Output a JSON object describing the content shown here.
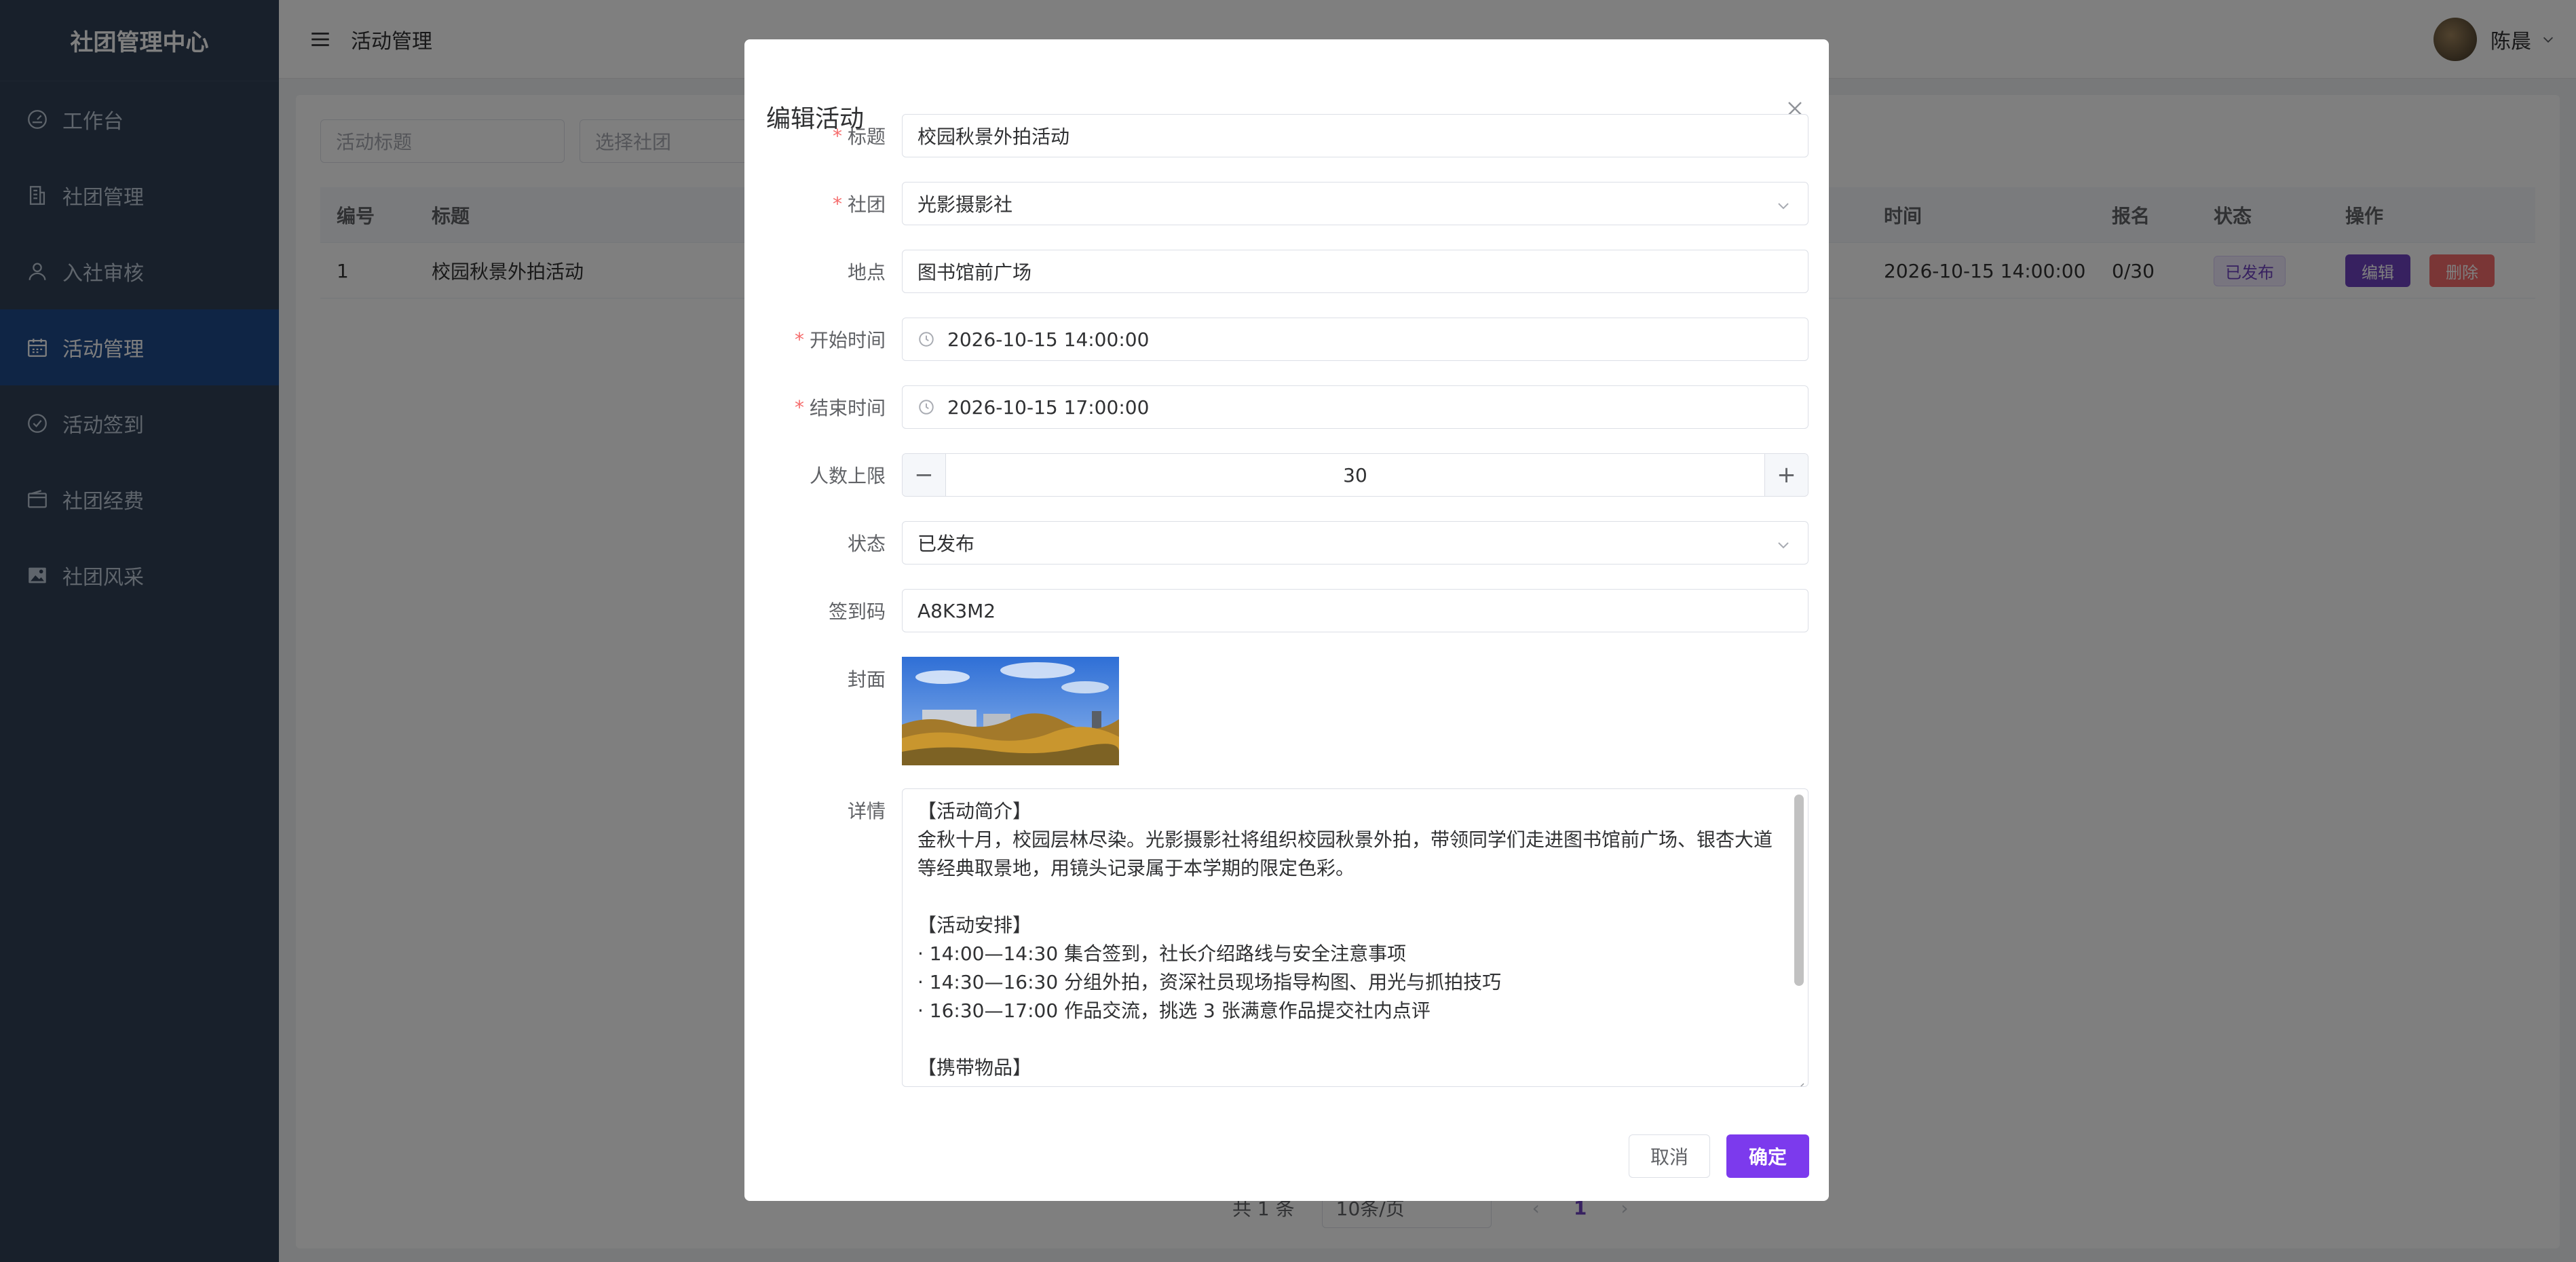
{
  "sidebar": {
    "title": "社团管理中心",
    "items": [
      {
        "label": "工作台",
        "icon": "dashboard-icon"
      },
      {
        "label": "社团管理",
        "icon": "building-icon"
      },
      {
        "label": "入社审核",
        "icon": "user-icon"
      },
      {
        "label": "活动管理",
        "icon": "calendar-icon",
        "active": true
      },
      {
        "label": "活动签到",
        "icon": "check-circle-icon"
      },
      {
        "label": "社团经费",
        "icon": "wallet-icon"
      },
      {
        "label": "社团风采",
        "icon": "image-icon"
      }
    ]
  },
  "header": {
    "breadcrumb": "活动管理",
    "username": "陈晨"
  },
  "filters": {
    "title_placeholder": "活动标题",
    "club_placeholder": "选择社团"
  },
  "table": {
    "headers": {
      "id": "编号",
      "title": "标题",
      "time": "时间",
      "signup": "报名",
      "status": "状态",
      "actions": "操作"
    },
    "rows": [
      {
        "id": "1",
        "title": "校园秋景外拍活动",
        "time": "2026-10-15 14:00:00",
        "signup": "0/30",
        "status": "已发布",
        "edit_label": "编辑",
        "delete_label": "删除"
      }
    ]
  },
  "pagination": {
    "total": "共 1 条",
    "page_size": "10条/页",
    "current": "1"
  },
  "dialog": {
    "title": "编辑活动",
    "fields": {
      "title_label": "标题",
      "title_value": "校园秋景外拍活动",
      "club_label": "社团",
      "club_value": "光影摄影社",
      "location_label": "地点",
      "location_value": "图书馆前广场",
      "start_label": "开始时间",
      "start_value": "2026-10-15 14:00:00",
      "end_label": "结束时间",
      "end_value": "2026-10-15 17:00:00",
      "limit_label": "人数上限",
      "limit_value": "30",
      "status_label": "状态",
      "status_value": "已发布",
      "code_label": "签到码",
      "code_value": "A8K3M2",
      "cover_label": "封面",
      "detail_label": "详情",
      "detail_lines": [
        "【活动简介】",
        "金秋十月，校园层林尽染。光影摄影社将组织校园秋景外拍，带领同学们走进图书馆前广场、银杏大道",
        "等经典取景地，用镜头记录属于本学期的限定色彩。",
        "",
        "【活动安排】",
        "· 14:00—14:30 集合签到，社长介绍路线与安全注意事项",
        "· 14:30—16:30 分组外拍，资深社员现场指导构图、用光与抓拍技巧",
        "· 16:30—17:00 作品交流，挑选 3 张满意作品提交社内点评",
        "",
        "【携带物品】"
      ]
    },
    "cancel_label": "取消",
    "ok_label": "确定"
  },
  "colors": {
    "sidebar_bg": "#304156",
    "sidebar_active": "#1f4a8a",
    "primary": "#7c3aed",
    "danger": "#f56c6c",
    "required": "#f56c6c"
  }
}
